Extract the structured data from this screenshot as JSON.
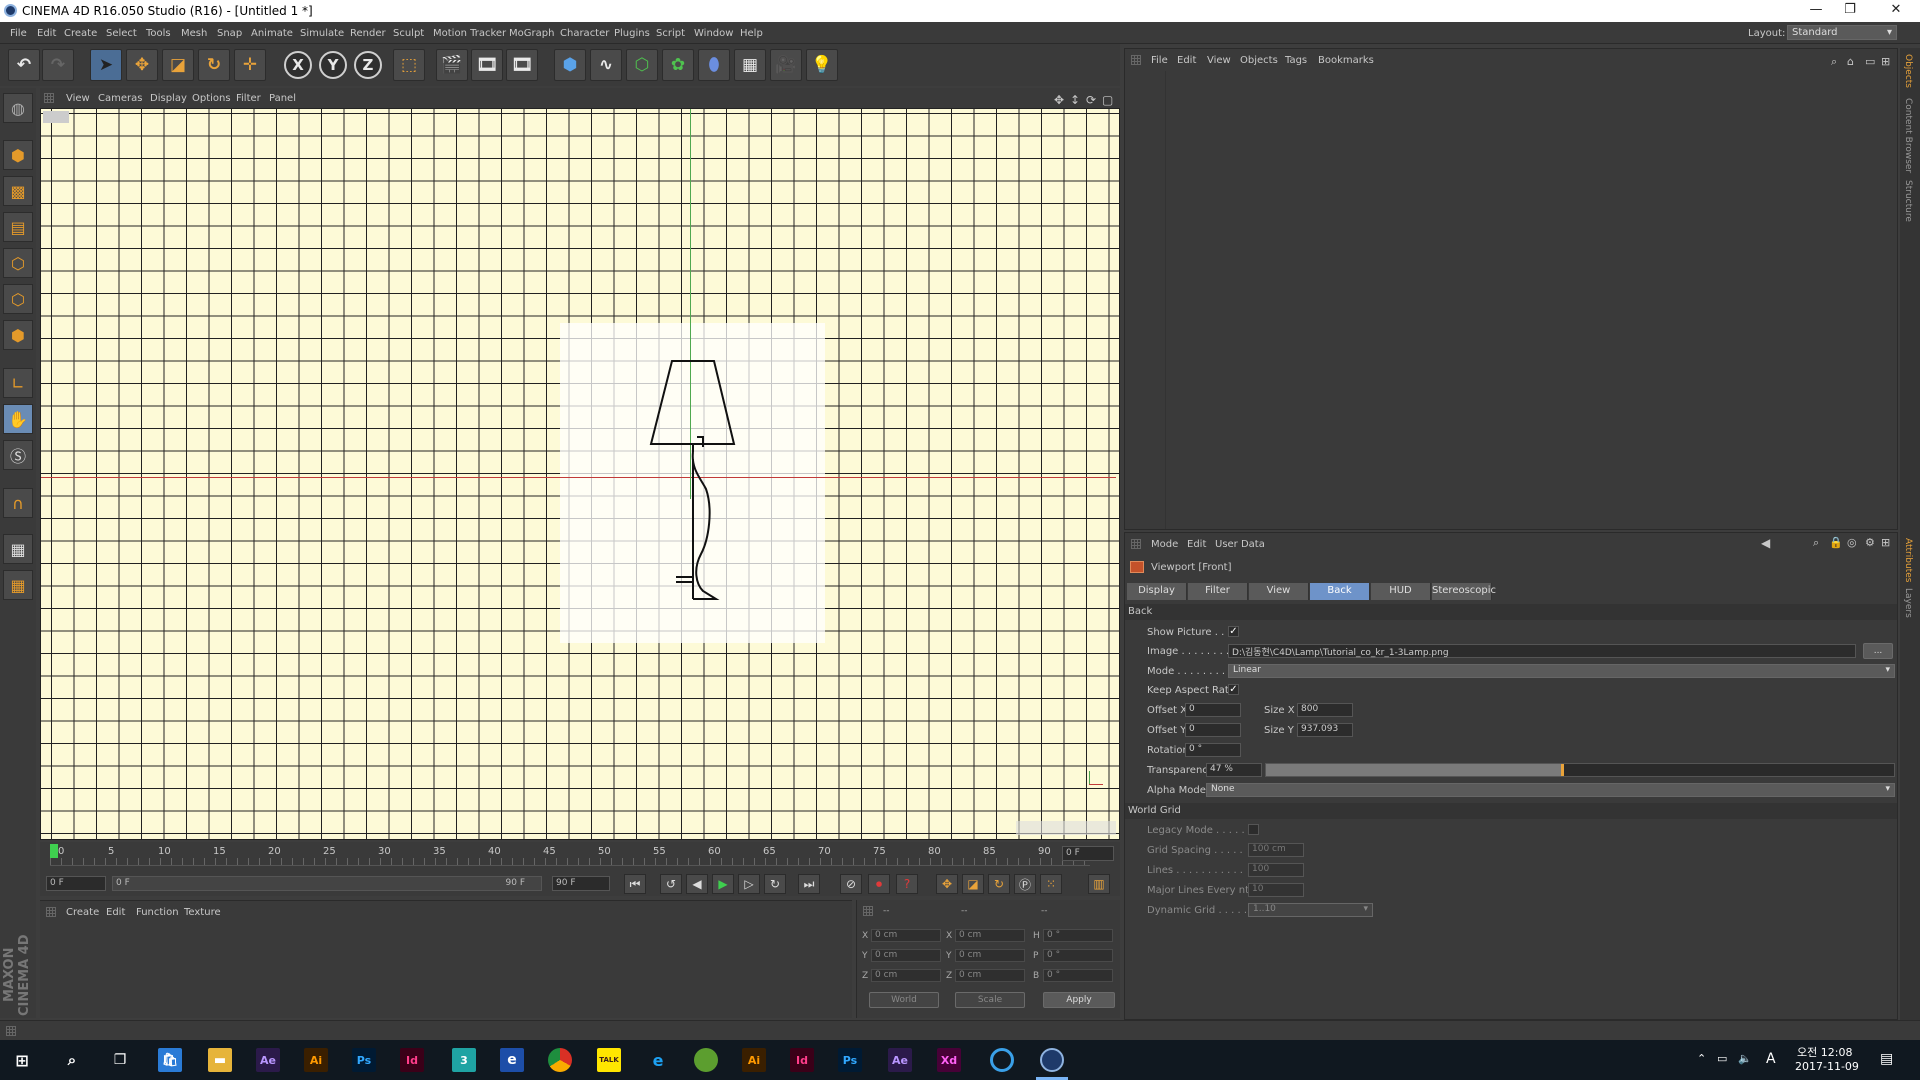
{
  "window": {
    "title": "CINEMA 4D R16.050 Studio (R16) - [Untitled 1 *]",
    "controls": [
      "—",
      "❐",
      "✕"
    ]
  },
  "menu": [
    "File",
    "Edit",
    "Create",
    "Select",
    "Tools",
    "Mesh",
    "Snap",
    "Animate",
    "Simulate",
    "Render",
    "Sculpt",
    "Motion Tracker",
    "MoGraph",
    "Character",
    "Plugins",
    "Script",
    "Window",
    "Help"
  ],
  "layout": {
    "label": "Layout:",
    "value": "Standard"
  },
  "toolbar": {
    "x": "X",
    "y": "Y",
    "z": "Z"
  },
  "viewport": {
    "menu": [
      "View",
      "Cameras",
      "Display",
      "Options",
      "Filter",
      "Panel"
    ]
  },
  "timeline": {
    "ticks": [
      "0",
      "5",
      "10",
      "15",
      "20",
      "25",
      "30",
      "35",
      "40",
      "45",
      "50",
      "55",
      "60",
      "65",
      "70",
      "75",
      "80",
      "85",
      "90"
    ],
    "current": "0 F"
  },
  "transport": {
    "start": "0 F",
    "slider_start": "0 F",
    "slider_end": "90 F",
    "end": "90 F"
  },
  "materials": {
    "menu": [
      "Create",
      "Edit",
      "Function",
      "Texture"
    ]
  },
  "coords": {
    "headers": [
      "--",
      "--",
      "--"
    ],
    "rows": [
      [
        "X",
        "0 cm",
        "X",
        "0 cm",
        "H",
        "0 °"
      ],
      [
        "Y",
        "0 cm",
        "Y",
        "0 cm",
        "P",
        "0 °"
      ],
      [
        "Z",
        "0 cm",
        "Z",
        "0 cm",
        "B",
        "0 °"
      ]
    ],
    "world": "World",
    "scale": "Scale",
    "apply": "Apply"
  },
  "objects": {
    "menu": [
      "File",
      "Edit",
      "View",
      "Objects",
      "Tags",
      "Bookmarks"
    ]
  },
  "side_tabs": [
    "Objects",
    "Content Browser",
    "Structure",
    "Attributes",
    "Layers"
  ],
  "attributes": {
    "menu": [
      "Mode",
      "Edit",
      "User Data"
    ],
    "title": "Viewport [Front]",
    "tabs": [
      "Display",
      "Filter",
      "View",
      "Back",
      "HUD",
      "Stereoscopic"
    ],
    "active_tab": "Back",
    "section_back": "Back",
    "show_picture_label": "Show Picture . . .",
    "image_label": "Image . . . . . . . .",
    "image_value": "D:\\김동현\\C4D\\Lamp\\Tutorial_co_kr_1-3Lamp.png",
    "image_btn": "...",
    "mode_label": "Mode . . . . . . . .",
    "mode_value": "Linear",
    "keep_aspect_label": "Keep Aspect Ratio",
    "offset_x_label": "Offset X",
    "offset_x": "0",
    "offset_y_label": "Offset Y",
    "offset_y": "0",
    "size_x_label": "Size X",
    "size_x": "800",
    "size_y_label": "Size Y",
    "size_y": "937.093",
    "rotation_label": "Rotation",
    "rotation": "0 °",
    "transparency_label": "Transparency",
    "transparency": "47 %",
    "transparency_level": 0.47,
    "alpha_label": "Alpha Mode",
    "alpha_value": "None",
    "section_grid": "World Grid",
    "legacy_label": "Legacy Mode . . . . . .",
    "spacing_label": "Grid Spacing . . . . .",
    "spacing": "100 cm",
    "lines_label": "Lines . . . . . . . . . . .",
    "lines": "100",
    "major_label": "Major Lines Every nth",
    "major": "10",
    "dynamic_label": "Dynamic Grid . . . . . .",
    "dynamic": "1..10"
  },
  "taskbar": {
    "apps": [
      "Ae",
      "Ai",
      "Ps",
      "Id",
      "3",
      "e",
      "",
      "TALK",
      "e",
      "",
      "Ai",
      "Id",
      "Ps",
      "Ae",
      "Xd",
      "",
      ""
    ],
    "time": "오전 12:08",
    "date": "2017-11-09",
    "lang": "A"
  },
  "colors": {
    "accent": "#6e93c9",
    "viewport_bg": "#fdfad7",
    "axis_x": "#c23a3a",
    "axis_y": "#4fa84f"
  }
}
